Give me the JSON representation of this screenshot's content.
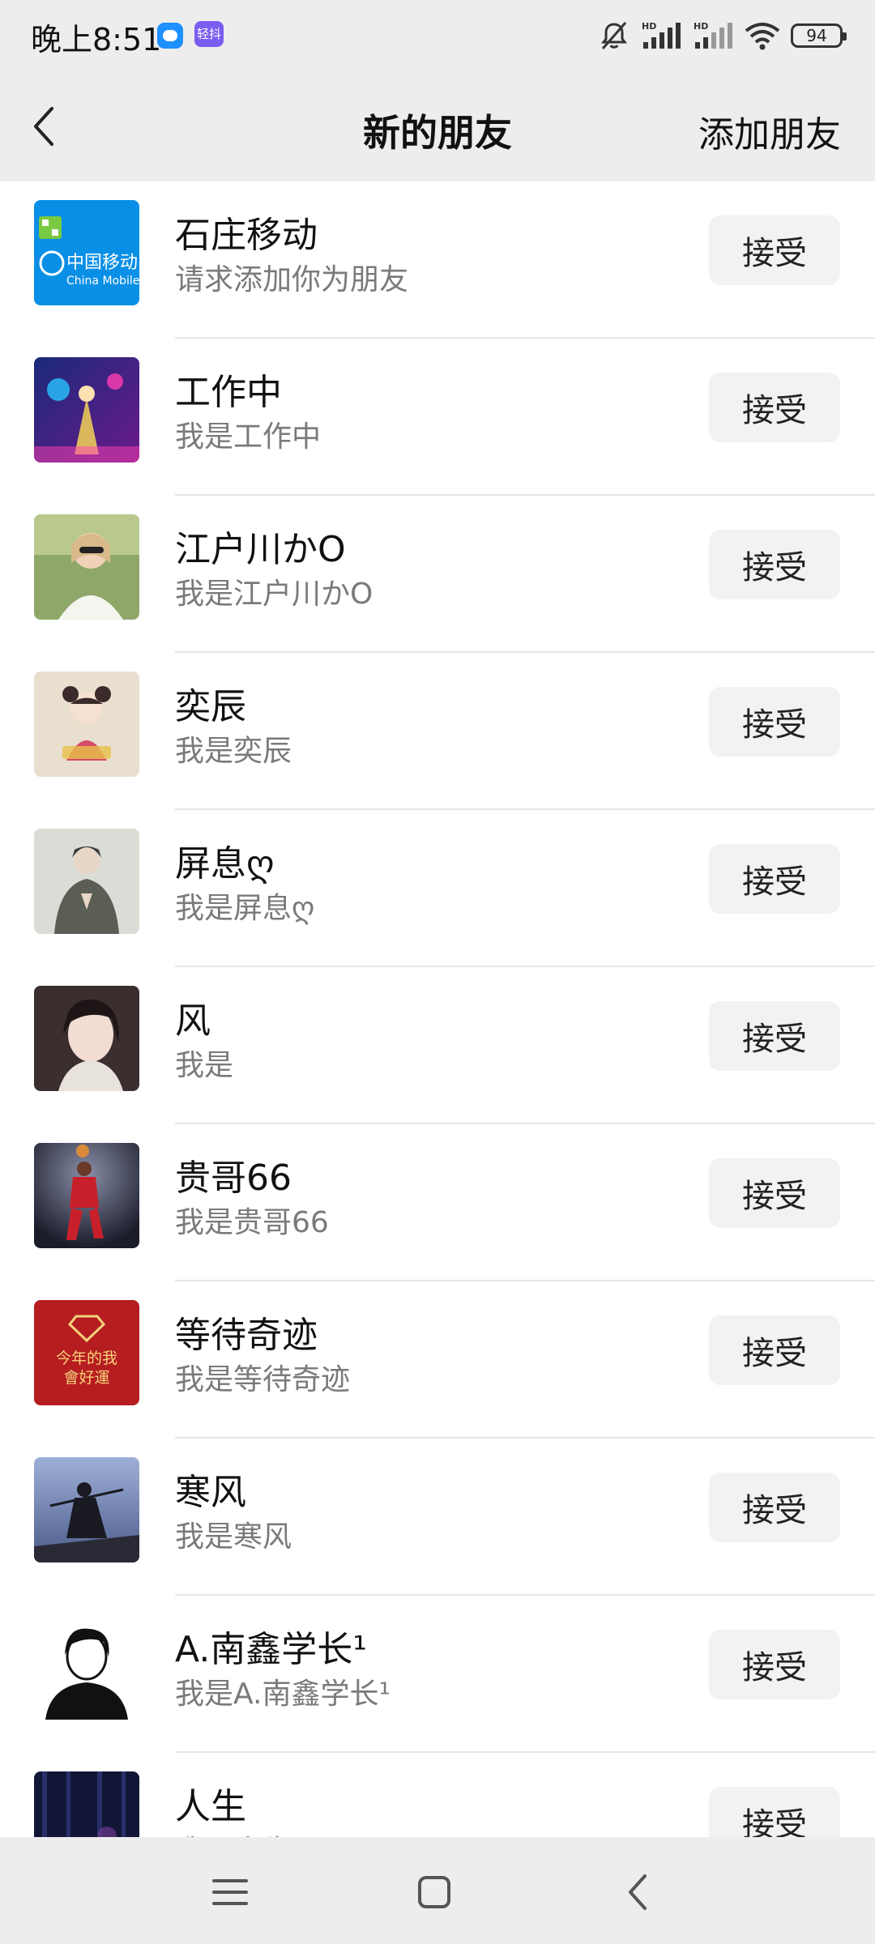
{
  "status_bar": {
    "time": "晚上8:51",
    "app_badge": "轻抖",
    "battery": "94",
    "icons": [
      "message-app-icon",
      "qingdou-app-icon",
      "mute-bell-icon",
      "hd-signal-icon",
      "hd-signal-icon",
      "wifi-icon",
      "battery-icon"
    ]
  },
  "nav": {
    "title": "新的朋友",
    "action": "添加朋友",
    "back_icon": "chevron-left-icon"
  },
  "friends": [
    {
      "name": "石庄移动",
      "message": "请求添加你为朋友",
      "button": "接受",
      "avatar": "china-mobile-logo"
    },
    {
      "name": "工作中",
      "message": "我是工作中",
      "button": "接受",
      "avatar": "neon-figure-photo"
    },
    {
      "name": "江户川かO",
      "message": "我是江户川かO",
      "button": "接受",
      "avatar": "girl-sunglasses-photo"
    },
    {
      "name": "奕辰",
      "message": "我是奕辰",
      "button": "接受",
      "avatar": "cartoon-girl-photo"
    },
    {
      "name": "屏息ღ",
      "message": "我是屏息ღ",
      "button": "接受",
      "avatar": "anime-boy-photo"
    },
    {
      "name": "风",
      "message": "我是",
      "button": "接受",
      "avatar": "girl-portrait-photo"
    },
    {
      "name": "贵哥66",
      "message": "我是贵哥66",
      "button": "接受",
      "avatar": "basketball-player-photo"
    },
    {
      "name": "等待奇迹",
      "message": "我是等待奇迹",
      "button": "接受",
      "avatar": "red-lucky-card",
      "avatar_text": "今年的我 會好運"
    },
    {
      "name": "寒风",
      "message": "我是寒风",
      "button": "接受",
      "avatar": "samurai-rain-photo"
    },
    {
      "name": "A.南鑫学长¹",
      "message": "我是A.南鑫学长¹",
      "button": "接受",
      "avatar": "anime-sketch-boy"
    },
    {
      "name": "人生",
      "message": "我是人生",
      "button": "接受",
      "avatar": "dark-forest-photo"
    }
  ],
  "system_nav": {
    "menu_icon": "menu-icon",
    "home_icon": "home-square-icon",
    "back_icon": "back-triangle-icon"
  }
}
